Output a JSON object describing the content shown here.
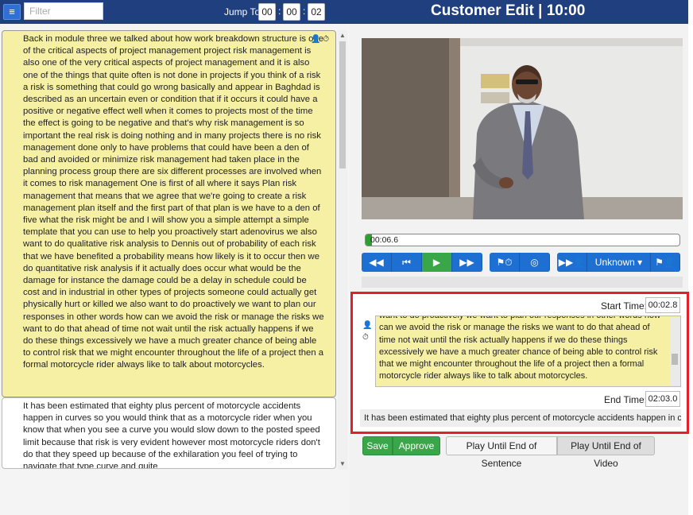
{
  "header": {
    "menu_icon": "menu-icon",
    "filter_placeholder": "Filter",
    "jump_label": "Jump To:",
    "jump_hours": "00",
    "jump_minutes": "00",
    "jump_seconds": "02",
    "title": "Customer Edit | 10:00",
    "colors": {
      "bar": "#1f3f7f",
      "accent": "#1e6fd2"
    }
  },
  "segments": [
    {
      "text": "Back in module three we talked about how work breakdown structure is one of the critical aspects of project management project risk management is also one of the very critical aspects of project management and it is also one of the things that quite often is not done in projects if you think of a risk a risk is something that could go wrong basically and appear in Baghdad is described as an uncertain even or condition that if it occurs it could have a positive or negative effect well when it comes to projects most of the time the effect is going to be negative and that's why risk management is so important the real risk is doing nothing and in many projects there is no risk management done only to have problems that could have been a den of bad and avoided or minimize risk management had taken place in the planning process group there are six different processes are involved when it comes to risk management One is first of all where it says Plan risk management that means that we agree that we're going to create a risk management plan itself and the first part of that plan is we have to a den of five what the risk might be and I will show you a simple attempt a simple template that you can use to help you proactively start adenovirus we also want to do qualitative risk analysis to Dennis out of probability of each risk that we have benefited a probability means how likely is it to occur then we do quantitative risk analysis if it actually does occur what would be the damage for instance the damage could be a delay in schedule could be cost and in industrial in other types of projects someone could actually get physically hurt or killed we also want to do proactively we want to plan our responses in other words how can we avoid the risk or manage the risks we want to do that ahead of time not wait until the risk actually happens if we do these things excessively we have a much greater chance of being able to control risk that we might encounter throughout the life of a project then a formal motorcycle rider always like to talk about motorcycles.",
      "icons": [
        "speaker-icon",
        "clock-icon"
      ]
    },
    {
      "text": "It has been estimated that eighty plus percent of motorcycle accidents happen in curves so you would think that as a motorcycle rider when you know that when you see a curve you would slow down to the posted speed limit because that risk is very evident however most motorcycle riders don't do that they speed up because of the exhilaration you feel of trying to navigate that type curve and quite"
    }
  ],
  "player": {
    "progress_text": "00:06.6",
    "progress_fraction": 0.01,
    "controls": {
      "rewind": "◀◀",
      "prev": "⏮",
      "play": "▶",
      "forward": "▶▶",
      "flag_clock": "⚑⏱",
      "target": "◎",
      "speaker_next": "▶▶👤",
      "speaker_name": "Unknown ▾",
      "flag_speaker": "⚑👤"
    }
  },
  "editor": {
    "start_label": "Start Time:",
    "start_value": "00:02.8",
    "end_label": "End Time:",
    "end_value": "02:03.0",
    "text": "want to do proactively we want to plan our responses in other words how can we avoid the risk or manage the risks we want to do that ahead of time not wait until the risk actually happens if we do these things excessively we have a much greater chance of being able to control risk that we might encounter throughout the life of a project then a formal motorcycle rider always like to talk about motorcycles.",
    "next_preview": "It has been estimated that eighty plus percent of motorcycle accidents happen in cur"
  },
  "footer": {
    "save": "Save",
    "approve": "Approve",
    "play_sentence": "Play Until End of Sentence",
    "play_video": "Play Until End of Video"
  }
}
